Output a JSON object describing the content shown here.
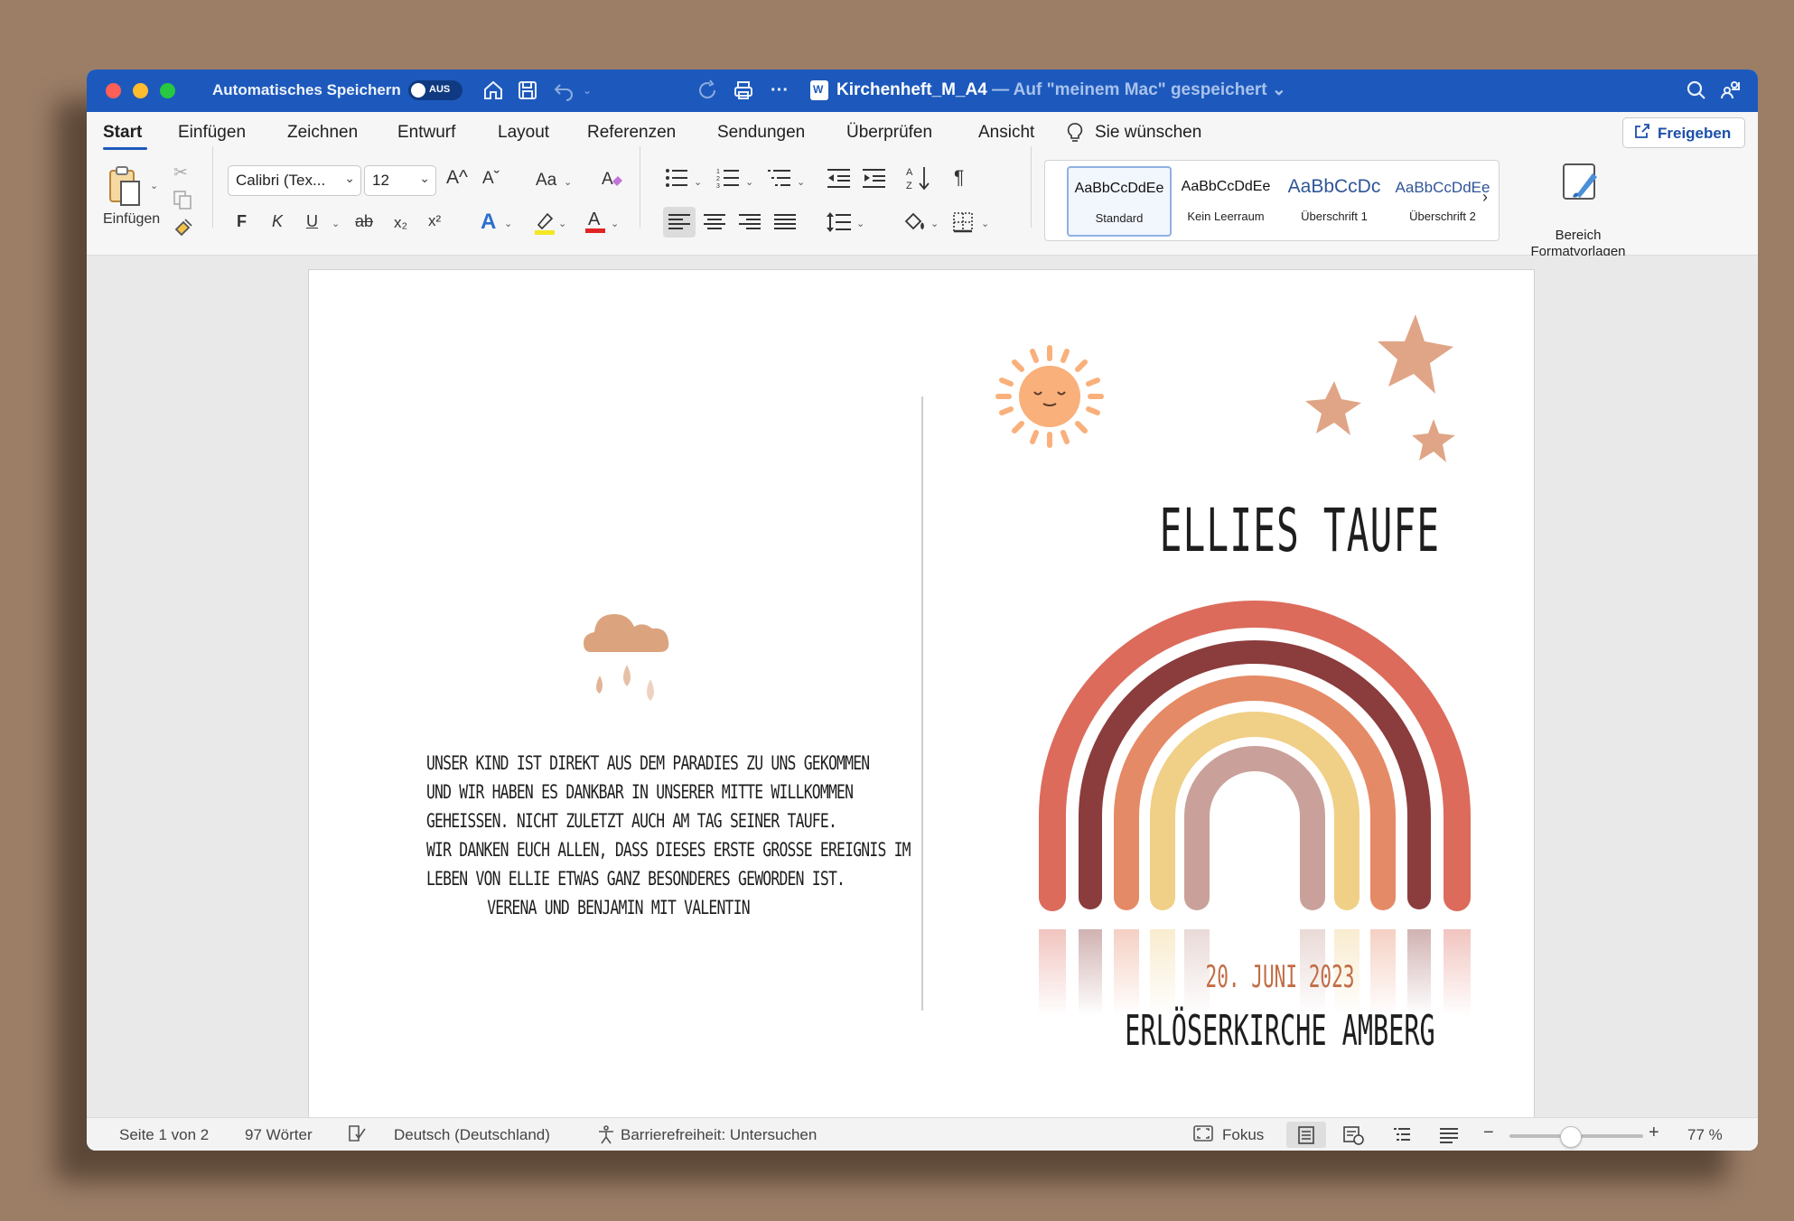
{
  "colors": {
    "background": "#9c7e67",
    "titlebar": "#1d59bc",
    "accent": "#1d59bc",
    "date": "#c26d45",
    "rainbow": [
      "#dc6b5c",
      "#8b3c3c",
      "#e58a66",
      "#f0cf86",
      "#caa19a"
    ],
    "sun": "#f9b07b",
    "stars": "#e0a586",
    "cloud": "#dba47e"
  },
  "titlebar": {
    "autosave_label": "Automatisches Speichern",
    "autosave_state": "AUS",
    "doc_name": "Kirchenheft_M_A4",
    "doc_saved": " — Auf \"meinem Mac\" gespeichert",
    "word_icon": "W"
  },
  "tabs": [
    {
      "label": "Start"
    },
    {
      "label": "Einfügen"
    },
    {
      "label": "Zeichnen"
    },
    {
      "label": "Entwurf"
    },
    {
      "label": "Layout"
    },
    {
      "label": "Referenzen"
    },
    {
      "label": "Sendungen"
    },
    {
      "label": "Überprüfen"
    },
    {
      "label": "Ansicht"
    },
    {
      "label": "Sie wünschen"
    }
  ],
  "share_label": "Freigeben",
  "ribbon": {
    "paste_label": "Einfügen",
    "font_name": "Calibri (Tex...",
    "font_size": "12",
    "grow_font": "A^",
    "shrink_font": "Aˇ",
    "change_case": "Aa",
    "bold": "F",
    "italic": "K",
    "underline": "U",
    "strike": "ab",
    "subscript": "x₂",
    "superscript": "x²",
    "pilcrow": "¶",
    "styles": [
      {
        "sample": "AaBbCcDdEe",
        "name": "Standard"
      },
      {
        "sample": "AaBbCcDdEe",
        "name": "Kein Leerraum"
      },
      {
        "sample": "AaBbCcDc",
        "name": "Überschrift 1"
      },
      {
        "sample": "AaBbCcDdEe",
        "name": "Überschrift 2"
      }
    ],
    "bereich_line1": "Bereich",
    "bereich_line2": "Formatvorlagen"
  },
  "document": {
    "verse_lines": [
      "Unser Kind ist direkt aus dem Paradies zu uns gekommen",
      "und wir haben es dankbar in unserer Mitte willkommen",
      "geheißen. Nicht zuletzt auch am Tag seiner Taufe.",
      "Wir danken euch allen, dass dieses erste große Ereignis im",
      "Leben von Ellie etwas ganz Besonderes geworden ist.",
      "Verena und Benjamin mit Valentin"
    ],
    "title": "Ellies Taufe",
    "date": "20. Juni 2023",
    "church": "Erlöserkirche Amberg"
  },
  "status": {
    "page": "Seite 1 von 2",
    "words": "97 Wörter",
    "language": "Deutsch (Deutschland)",
    "accessibility": "Barrierefreiheit: Untersuchen",
    "focus": "Fokus",
    "zoom": "77 %",
    "zoom_level": 0.46
  }
}
